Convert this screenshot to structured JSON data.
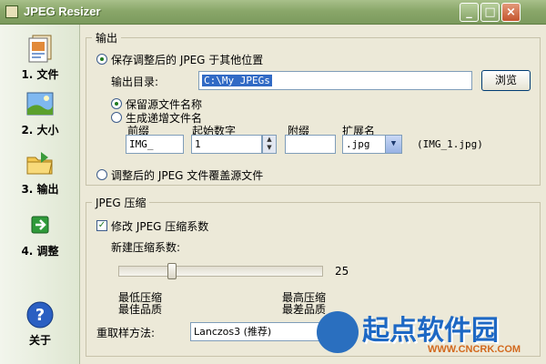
{
  "window": {
    "title": "JPEG Resizer",
    "minimize_glyph": "_",
    "maximize_glyph": "□",
    "close_glyph": "×"
  },
  "sidebar": {
    "items": [
      {
        "label": "1. 文件",
        "icon": "files-icon"
      },
      {
        "label": "2. 大小",
        "icon": "landscape-icon"
      },
      {
        "label": "3. 输出",
        "icon": "folder-icon"
      },
      {
        "label": "4. 调整",
        "icon": "green-arrow-icon"
      }
    ],
    "about": {
      "label": "关于",
      "icon": "help-icon"
    }
  },
  "output": {
    "group_title": "输出",
    "save_elsewhere_label": "保存调整后的 JPEG 于其他位置",
    "dir_label": "输出目录:",
    "dir_value": "C:\\My JPEGs",
    "browse_label": "浏览",
    "keep_name_label": "保留源文件名称",
    "incremental_label": "生成递增文件名",
    "prefix_label": "前缀",
    "prefix_value": "IMG_",
    "start_label": "起始数字",
    "start_value": "1",
    "suffix_label": "附缀",
    "suffix_value": "",
    "ext_label": "扩展名",
    "ext_value": ".jpg",
    "example": "(IMG_1.jpg)",
    "overwrite_label": "调整后的 JPEG 文件覆盖源文件"
  },
  "compression": {
    "group_title": "JPEG 压缩",
    "modify_label": "修改 JPEG 压缩系数",
    "new_factor_label": "新建压缩系数:",
    "value": 25,
    "min": 0,
    "max": 100,
    "low_line1": "最低压缩",
    "low_line2": "最佳品质",
    "high_line1": "最高压缩",
    "high_line2": "最差品质",
    "resample_label": "重取样方法:",
    "resample_value": "Lanczos3 (推荐)"
  },
  "watermark": {
    "title": "起点软件园",
    "url": "WWW.CNCRK.COM"
  }
}
